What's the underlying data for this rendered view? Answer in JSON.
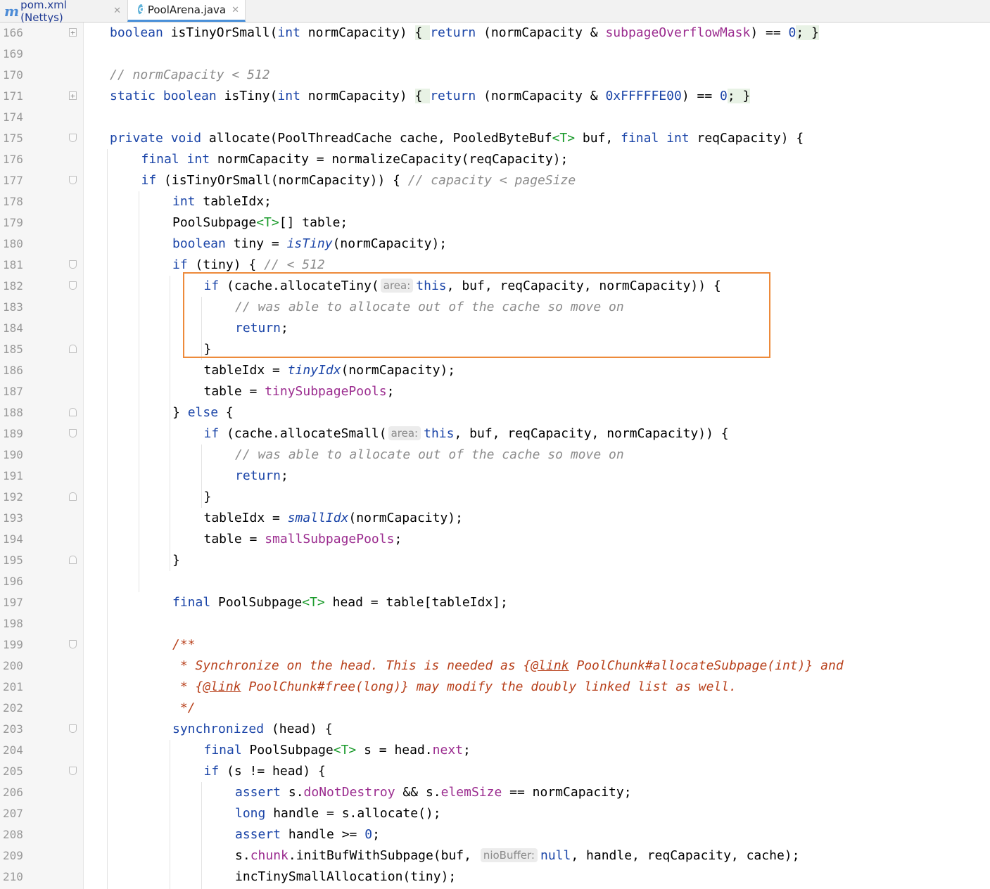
{
  "tabs": [
    {
      "label": "pom.xml (Nettys)",
      "icon": "maven-icon",
      "active": false
    },
    {
      "label": "PoolArena.java",
      "icon": "java-class-icon",
      "active": true
    }
  ],
  "colors": {
    "highlight_box": "#ed8a3a",
    "keyword": "#1b45a8",
    "field": "#9b2c8f",
    "comment": "#8c8c8c",
    "javadoc": "#b8411c"
  },
  "lines": [
    {
      "n": "166",
      "fold": "plus",
      "tokens": [
        [
          "kw",
          "boolean "
        ],
        [
          "",
          "isTinyOrSmall("
        ],
        [
          "kw",
          "int "
        ],
        [
          "",
          "normCapacity) "
        ],
        [
          "bh",
          "{ "
        ],
        [
          "kw",
          "return "
        ],
        [
          "",
          "(normCapacity & "
        ],
        [
          "fld",
          "subpageOverflowMask"
        ],
        [
          "",
          ") == "
        ],
        [
          "num",
          "0"
        ],
        [
          ";",
          ""
        ],
        [
          "bh",
          "; }"
        ]
      ]
    },
    {
      "n": "169",
      "tokens": []
    },
    {
      "n": "170",
      "tokens": [
        [
          "cmt",
          "// normCapacity < 512"
        ]
      ]
    },
    {
      "n": "171",
      "fold": "plus",
      "tokens": [
        [
          "kw",
          "static boolean "
        ],
        [
          "",
          "isTiny("
        ],
        [
          "kw",
          "int "
        ],
        [
          "",
          "normCapacity) "
        ],
        [
          "bh",
          "{ "
        ],
        [
          "kw",
          "return "
        ],
        [
          "",
          "(normCapacity & "
        ],
        [
          "num",
          "0xFFFFFE00"
        ],
        [
          "",
          ") == "
        ],
        [
          "num",
          "0"
        ],
        [
          "bh",
          "; }"
        ]
      ]
    },
    {
      "n": "174",
      "tokens": []
    },
    {
      "n": "175",
      "fold": "down",
      "tokens": [
        [
          "kw",
          "private void "
        ],
        [
          "",
          "allocate(PoolThreadCache cache, PooledByteBuf"
        ],
        [
          "ty",
          "<T>"
        ],
        [
          "",
          " buf, "
        ],
        [
          "kw",
          "final int "
        ],
        [
          "",
          "reqCapacity) {"
        ]
      ]
    },
    {
      "n": "176",
      "indent": 1,
      "tokens": [
        [
          "kw",
          "final int "
        ],
        [
          "",
          "normCapacity = normalizeCapacity(reqCapacity);"
        ]
      ]
    },
    {
      "n": "177",
      "indent": 1,
      "fold": "down",
      "tokens": [
        [
          "kw",
          "if "
        ],
        [
          "",
          "(isTinyOrSmall(normCapacity)) { "
        ],
        [
          "cmt",
          "// capacity < pageSize"
        ]
      ]
    },
    {
      "n": "178",
      "indent": 2,
      "tokens": [
        [
          "kw",
          "int "
        ],
        [
          "",
          "tableIdx;"
        ]
      ]
    },
    {
      "n": "179",
      "indent": 2,
      "tokens": [
        [
          "",
          "PoolSubpage"
        ],
        [
          "ty",
          "<T>"
        ],
        [
          "",
          "[] table;"
        ]
      ]
    },
    {
      "n": "180",
      "indent": 2,
      "tokens": [
        [
          "kw",
          "boolean "
        ],
        [
          "",
          "tiny = "
        ],
        [
          "st",
          "isTiny"
        ],
        [
          "",
          "(normCapacity);"
        ]
      ]
    },
    {
      "n": "181",
      "indent": 2,
      "fold": "down",
      "tokens": [
        [
          "kw",
          "if "
        ],
        [
          "",
          "(tiny) { "
        ],
        [
          "cmt",
          "// < 512"
        ]
      ]
    },
    {
      "n": "182",
      "indent": 3,
      "fold": "down",
      "tokens": [
        [
          "kw",
          "if "
        ],
        [
          "",
          "(cache.allocateTiny("
        ],
        [
          "hint",
          "area:"
        ],
        [
          "kw",
          "this"
        ],
        [
          "",
          ", buf, reqCapacity, normCapacity)) {"
        ]
      ]
    },
    {
      "n": "183",
      "indent": 4,
      "tokens": [
        [
          "cmt",
          "// was able to allocate out of the cache so move on"
        ]
      ]
    },
    {
      "n": "184",
      "indent": 4,
      "tokens": [
        [
          "kw",
          "return"
        ],
        [
          "",
          ";"
        ]
      ]
    },
    {
      "n": "185",
      "indent": 3,
      "fold": "up",
      "tokens": [
        [
          "",
          "}"
        ]
      ]
    },
    {
      "n": "186",
      "indent": 3,
      "tokens": [
        [
          "",
          "tableIdx = "
        ],
        [
          "st",
          "tinyIdx"
        ],
        [
          "",
          "(normCapacity);"
        ]
      ]
    },
    {
      "n": "187",
      "indent": 3,
      "tokens": [
        [
          "",
          "table = "
        ],
        [
          "fld",
          "tinySubpagePools"
        ],
        [
          "",
          ";"
        ]
      ]
    },
    {
      "n": "188",
      "indent": 2,
      "fold": "up",
      "tokens": [
        [
          "",
          "} "
        ],
        [
          "kw",
          "else "
        ],
        [
          "",
          "{"
        ]
      ]
    },
    {
      "n": "189",
      "indent": 3,
      "fold": "down",
      "tokens": [
        [
          "kw",
          "if "
        ],
        [
          "",
          "(cache.allocateSmall("
        ],
        [
          "hint",
          "area:"
        ],
        [
          "kw",
          "this"
        ],
        [
          "",
          ", buf, reqCapacity, normCapacity)) {"
        ]
      ]
    },
    {
      "n": "190",
      "indent": 4,
      "tokens": [
        [
          "cmt",
          "// was able to allocate out of the cache so move on"
        ]
      ]
    },
    {
      "n": "191",
      "indent": 4,
      "tokens": [
        [
          "kw",
          "return"
        ],
        [
          "",
          ";"
        ]
      ]
    },
    {
      "n": "192",
      "indent": 3,
      "fold": "up",
      "tokens": [
        [
          "",
          "}"
        ]
      ]
    },
    {
      "n": "193",
      "indent": 3,
      "tokens": [
        [
          "",
          "tableIdx = "
        ],
        [
          "st",
          "smallIdx"
        ],
        [
          "",
          "(normCapacity);"
        ]
      ]
    },
    {
      "n": "194",
      "indent": 3,
      "tokens": [
        [
          "",
          "table = "
        ],
        [
          "fld",
          "smallSubpagePools"
        ],
        [
          "",
          ";"
        ]
      ]
    },
    {
      "n": "195",
      "indent": 2,
      "fold": "up",
      "tokens": [
        [
          "",
          "}"
        ]
      ]
    },
    {
      "n": "196",
      "tokens": []
    },
    {
      "n": "197",
      "indent": 2,
      "tokens": [
        [
          "kw",
          "final "
        ],
        [
          "",
          "PoolSubpage"
        ],
        [
          "ty",
          "<T>"
        ],
        [
          "",
          " head = table[tableIdx];"
        ]
      ]
    },
    {
      "n": "198",
      "tokens": []
    },
    {
      "n": "199",
      "indent": 2,
      "fold": "down",
      "tokens": [
        [
          "doc",
          "/**"
        ]
      ]
    },
    {
      "n": "200",
      "indent": 2,
      "tokens": [
        [
          "doc",
          " * Synchronize on the head. This is needed as {"
        ],
        [
          "doctag",
          "@link"
        ],
        [
          "doc",
          " PoolChunk#allocateSubpage(int)} and"
        ]
      ]
    },
    {
      "n": "201",
      "indent": 2,
      "tokens": [
        [
          "doc",
          " * {"
        ],
        [
          "doctag",
          "@link"
        ],
        [
          "doc",
          " PoolChunk#free(long)} may modify the doubly linked list as well."
        ]
      ]
    },
    {
      "n": "202",
      "indent": 2,
      "tokens": [
        [
          "doc",
          " */"
        ]
      ]
    },
    {
      "n": "203",
      "indent": 2,
      "fold": "down",
      "tokens": [
        [
          "kw",
          "synchronized "
        ],
        [
          "",
          "(head) {"
        ]
      ]
    },
    {
      "n": "204",
      "indent": 3,
      "tokens": [
        [
          "kw",
          "final "
        ],
        [
          "",
          "PoolSubpage"
        ],
        [
          "ty",
          "<T>"
        ],
        [
          "",
          " s = head."
        ],
        [
          "fld",
          "next"
        ],
        [
          "",
          ";"
        ]
      ]
    },
    {
      "n": "205",
      "indent": 3,
      "fold": "down",
      "tokens": [
        [
          "kw",
          "if "
        ],
        [
          "",
          "(s != head) {"
        ]
      ]
    },
    {
      "n": "206",
      "indent": 4,
      "tokens": [
        [
          "kw",
          "assert "
        ],
        [
          "",
          "s."
        ],
        [
          "fld",
          "doNotDestroy"
        ],
        [
          "",
          " && s."
        ],
        [
          "fld",
          "elemSize"
        ],
        [
          "",
          " == normCapacity;"
        ]
      ]
    },
    {
      "n": "207",
      "indent": 4,
      "tokens": [
        [
          "kw",
          "long "
        ],
        [
          "",
          "handle = s.allocate();"
        ]
      ]
    },
    {
      "n": "208",
      "indent": 4,
      "tokens": [
        [
          "kw",
          "assert "
        ],
        [
          "",
          "handle >= "
        ],
        [
          "num",
          "0"
        ],
        [
          "",
          ";"
        ]
      ]
    },
    {
      "n": "209",
      "indent": 4,
      "tokens": [
        [
          "",
          "s."
        ],
        [
          "fld",
          "chunk"
        ],
        [
          "",
          ".initBufWithSubpage(buf, "
        ],
        [
          "hint",
          "nioBuffer:"
        ],
        [
          "kw",
          "null"
        ],
        [
          "",
          ", handle, reqCapacity, cache);"
        ]
      ]
    },
    {
      "n": "210",
      "indent": 4,
      "tokens": [
        [
          "",
          "incTinySmallAllocation(tiny);"
        ]
      ]
    }
  ]
}
